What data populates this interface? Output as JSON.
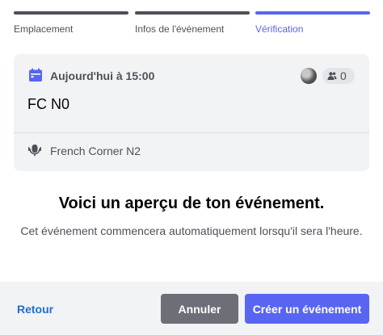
{
  "steps": [
    {
      "label": "Emplacement",
      "state": "done"
    },
    {
      "label": "Infos de l'événement",
      "state": "done"
    },
    {
      "label": "Vérification",
      "state": "active"
    }
  ],
  "preview": {
    "date_label": "Aujourd'hui à 15:00",
    "interested_count": "0",
    "event_name": "FC N0",
    "channel_name": "French Corner N2"
  },
  "headline": "Voici un aperçu de ton événement.",
  "description": "Cet événement commencera automatiquement lorsqu'il sera l'heure.",
  "footer": {
    "back_label": "Retour",
    "cancel_label": "Annuler",
    "create_label": "Créer un événement"
  },
  "colors": {
    "accent": "#5865f2",
    "step_inactive": "#4e5058",
    "cancel_bg": "#6d6f78",
    "link": "#1f6fcf"
  },
  "icons": [
    "calendar-icon",
    "people-icon",
    "stage-channel-icon"
  ]
}
